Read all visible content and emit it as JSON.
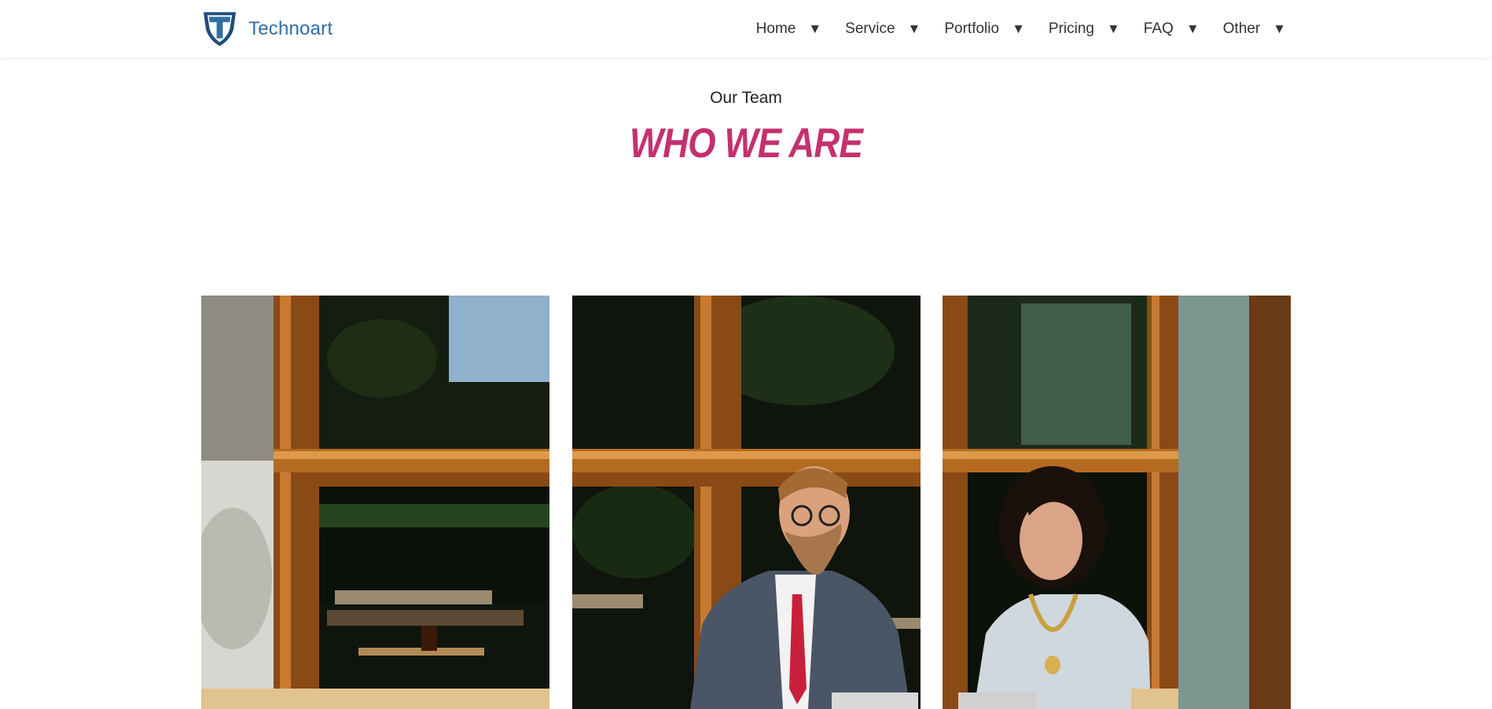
{
  "brand": {
    "name": "Technoart",
    "logo_icon": "shield-t-logo-icon"
  },
  "nav": {
    "items": [
      {
        "label": "Home",
        "icon": "caret-down-icon",
        "caret": "▼"
      },
      {
        "label": "Service",
        "icon": "caret-down-icon",
        "caret": "▼"
      },
      {
        "label": "Portfolio",
        "icon": "caret-down-icon",
        "caret": "▼"
      },
      {
        "label": "Pricing",
        "icon": "caret-down-icon",
        "caret": "▼"
      },
      {
        "label": "FAQ",
        "icon": "caret-down-icon",
        "caret": "▼"
      },
      {
        "label": "Other",
        "icon": "caret-down-icon",
        "caret": "▼"
      }
    ]
  },
  "team_section": {
    "subtitle": "Our Team",
    "title": "WHO WE ARE",
    "members": [
      {
        "photo": "cafe-window-empty-table-photo"
      },
      {
        "photo": "bearded-man-in-suit-photo"
      },
      {
        "photo": "curly-haired-woman-photo"
      }
    ]
  },
  "colors": {
    "brand": "#2f6ea4",
    "accent": "#c4316f",
    "nav_text": "#333333",
    "background": "#ffffff"
  }
}
